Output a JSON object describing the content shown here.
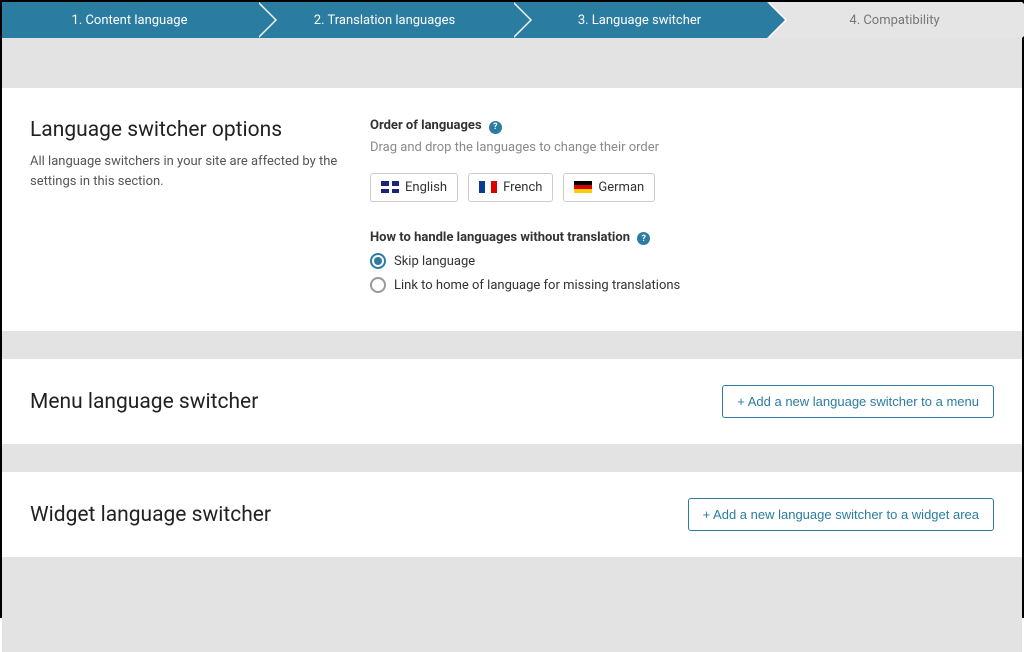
{
  "wizard": {
    "steps": [
      {
        "label": "1. Content language",
        "state": "done"
      },
      {
        "label": "2. Translation languages",
        "state": "done"
      },
      {
        "label": "3. Language switcher",
        "state": "current"
      },
      {
        "label": "4. Compatibility",
        "state": "idle"
      }
    ]
  },
  "options_panel": {
    "title": "Language switcher options",
    "subtitle": "All language switchers in your site are affected by the settings in this section.",
    "order_section": {
      "label": "Order of languages",
      "hint": "Drag and drop the languages to change their order",
      "items": [
        {
          "name": "English",
          "flag": "flag-uk"
        },
        {
          "name": "French",
          "flag": "flag-fr"
        },
        {
          "name": "German",
          "flag": "flag-de"
        }
      ]
    },
    "missing_section": {
      "label": "How to handle languages without translation",
      "options": [
        {
          "label": "Skip language",
          "checked": true
        },
        {
          "label": "Link to home of language for missing translations",
          "checked": false
        }
      ]
    }
  },
  "menu_panel": {
    "title": "Menu language switcher",
    "button": "+ Add a new language switcher to a menu"
  },
  "widget_panel": {
    "title": "Widget language switcher",
    "button": "+ Add a new language switcher to a widget area"
  }
}
